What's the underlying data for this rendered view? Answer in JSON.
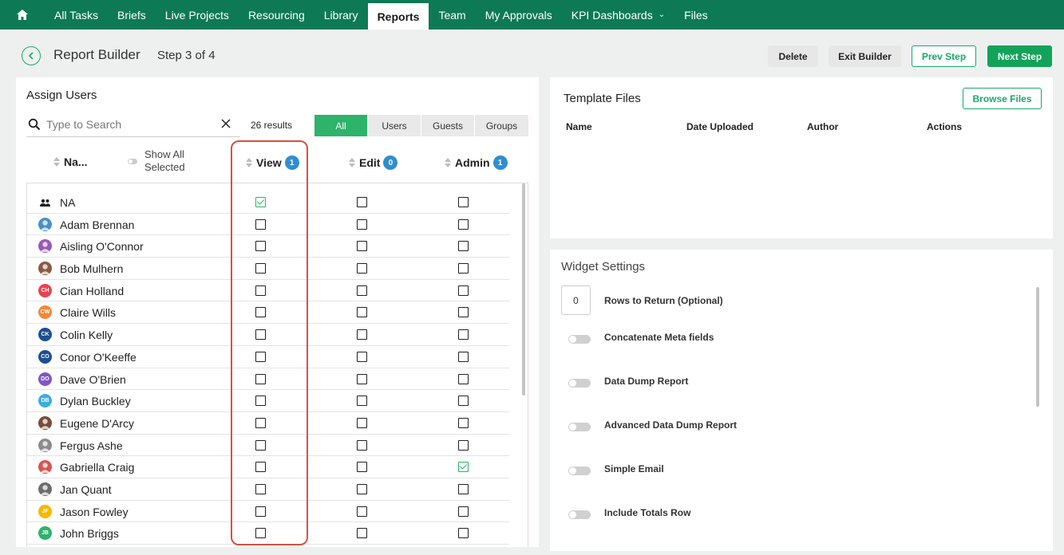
{
  "nav": {
    "home_icon": "home-icon",
    "items": [
      {
        "label": "All Tasks",
        "active": false
      },
      {
        "label": "Briefs",
        "active": false
      },
      {
        "label": "Live Projects",
        "active": false
      },
      {
        "label": "Resourcing",
        "active": false
      },
      {
        "label": "Library",
        "active": false
      },
      {
        "label": "Reports",
        "active": true
      },
      {
        "label": "Team",
        "active": false
      },
      {
        "label": "My Approvals",
        "active": false
      },
      {
        "label": "KPI Dashboards",
        "active": false,
        "has_dropdown": true
      },
      {
        "label": "Files",
        "active": false
      }
    ]
  },
  "header": {
    "title": "Report Builder",
    "step": "Step 3 of 4",
    "delete_label": "Delete",
    "exit_label": "Exit Builder",
    "prev_label": "Prev Step",
    "next_label": "Next Step"
  },
  "assign": {
    "heading": "Assign Users",
    "search_placeholder": "Type to Search",
    "results": "26 results",
    "filters": [
      "All",
      "Users",
      "Guests",
      "Groups"
    ],
    "active_filter": "All",
    "col_name": "Na...",
    "show_all": "Show All Selected",
    "col_view": "View",
    "view_count": "1",
    "col_edit": "Edit",
    "edit_count": "0",
    "col_admin": "Admin",
    "admin_count": "1",
    "rows": [
      {
        "name": "NA",
        "initials": "",
        "color": "",
        "group": true,
        "view": true,
        "edit": false,
        "admin": false
      },
      {
        "name": "Adam Brennan",
        "initials": "",
        "color": "#4a90c8",
        "view": false,
        "edit": false,
        "admin": false
      },
      {
        "name": "Aisling O'Connor",
        "initials": "",
        "color": "#9b59b6",
        "view": false,
        "edit": false,
        "admin": false
      },
      {
        "name": "Bob Mulhern",
        "initials": "",
        "color": "#8a5a44",
        "view": false,
        "edit": false,
        "admin": false
      },
      {
        "name": "Cian Holland",
        "initials": "CH",
        "color": "#e8434f",
        "view": false,
        "edit": false,
        "admin": false
      },
      {
        "name": "Claire Wills",
        "initials": "CW",
        "color": "#f0883a",
        "view": false,
        "edit": false,
        "admin": false
      },
      {
        "name": "Colin Kelly",
        "initials": "CK",
        "color": "#1d4f91",
        "view": false,
        "edit": false,
        "admin": false
      },
      {
        "name": "Conor O'Keeffe",
        "initials": "CO",
        "color": "#1d4f91",
        "view": false,
        "edit": false,
        "admin": false
      },
      {
        "name": "Dave O'Brien",
        "initials": "DO",
        "color": "#7e57c2",
        "view": false,
        "edit": false,
        "admin": false
      },
      {
        "name": "Dylan Buckley",
        "initials": "DB",
        "color": "#3aaee0",
        "view": false,
        "edit": false,
        "admin": false
      },
      {
        "name": "Eugene D'Arcy",
        "initials": "",
        "color": "#7a4a3a",
        "view": false,
        "edit": false,
        "admin": false
      },
      {
        "name": "Fergus Ashe",
        "initials": "",
        "color": "#8c8c8c",
        "view": false,
        "edit": false,
        "admin": false
      },
      {
        "name": "Gabriella Craig",
        "initials": "",
        "color": "#d9534f",
        "view": false,
        "edit": false,
        "admin": true
      },
      {
        "name": "Jan Quant",
        "initials": "",
        "color": "#6d6d6d",
        "view": false,
        "edit": false,
        "admin": false
      },
      {
        "name": "Jason Fowley",
        "initials": "JF",
        "color": "#f5b800",
        "view": false,
        "edit": false,
        "admin": false
      },
      {
        "name": "John Briggs",
        "initials": "JB",
        "color": "#2db36a",
        "view": false,
        "edit": false,
        "admin": false
      }
    ]
  },
  "template": {
    "heading": "Template Files",
    "browse_label": "Browse Files",
    "columns": [
      "Name",
      "Date Uploaded",
      "Author",
      "Actions"
    ]
  },
  "widget": {
    "heading": "Widget Settings",
    "rows_value": "0",
    "rows_label": "Rows to Return (Optional)",
    "toggles": [
      {
        "label": "Concatenate Meta fields",
        "on": false
      },
      {
        "label": "Data Dump Report",
        "on": false
      },
      {
        "label": "Advanced Data Dump Report",
        "on": false
      },
      {
        "label": "Simple Email",
        "on": false
      },
      {
        "label": "Include Totals Row",
        "on": false
      }
    ]
  },
  "colors": {
    "nav_bg": "#0d7a55",
    "accent_green": "#12a35a",
    "badge_blue": "#2f8ed0",
    "highlight_red": "#d9503f"
  }
}
